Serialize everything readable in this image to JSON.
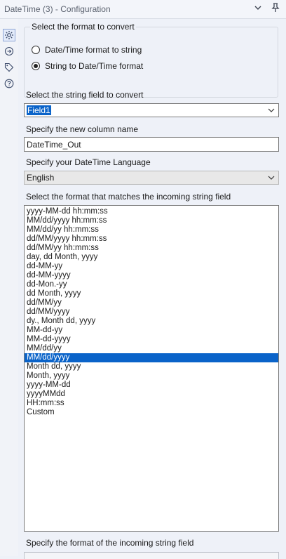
{
  "window": {
    "title": "DateTime (3) - Configuration",
    "icons": [
      "chevron-down-icon",
      "pin-icon"
    ]
  },
  "sidebar": {
    "menu_dots": "···",
    "icons": [
      "gear-icon",
      "connection-icon",
      "tag-icon",
      "help-icon"
    ]
  },
  "format_group": {
    "title": "Select the format to convert",
    "options": [
      {
        "label": "Date/Time format to string",
        "checked": false
      },
      {
        "label": "String to Date/Time format",
        "checked": true
      }
    ]
  },
  "string_field": {
    "label": "Select the string field to convert",
    "value": "Field1"
  },
  "new_column": {
    "label": "Specify the new column name",
    "value": "DateTime_Out"
  },
  "language": {
    "label": "Specify your DateTime Language",
    "value": "English"
  },
  "format_list": {
    "label": "Select the format that matches the incoming string field",
    "items": [
      "yyyy-MM-dd hh:mm:ss",
      "MM/dd/yyyy hh:mm:ss",
      "MM/dd/yy hh:mm:ss",
      "dd/MM/yyyy hh:mm:ss",
      "dd/MM/yy hh:mm:ss",
      "day, dd Month, yyyy",
      "dd-MM-yy",
      "dd-MM-yyyy",
      "dd-Mon.-yy",
      "dd Month, yyyy",
      "dd/MM/yy",
      "dd/MM/yyyy",
      "dy., Month dd, yyyy",
      "MM-dd-yy",
      "MM-dd-yyyy",
      "MM/dd/yy",
      "MM/dd/yyyy",
      "Month dd, yyyy",
      "Month, yyyy",
      "yyyy-MM-dd",
      "yyyyMMdd",
      "HH:mm:ss",
      "Custom"
    ],
    "selected_index": 16
  },
  "incoming_format": {
    "label": "Specify the format of the incoming string field"
  },
  "colors": {
    "accent": "#0a63c9",
    "background": "#eef1f8"
  }
}
